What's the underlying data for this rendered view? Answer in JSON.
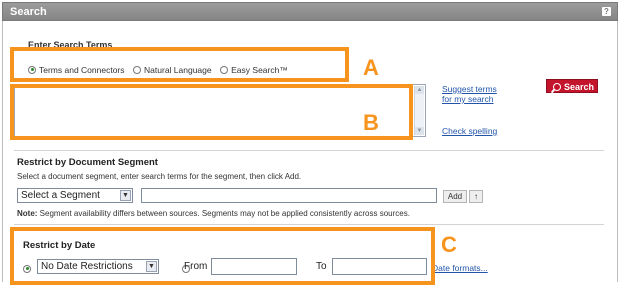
{
  "window": {
    "title": "Search",
    "help_label": "?"
  },
  "enter_terms": {
    "heading": "Enter Search Terms",
    "options": [
      {
        "label": "Terms and Connectors",
        "selected": true
      },
      {
        "label": "Natural Language",
        "selected": false
      },
      {
        "label": "Easy Search™",
        "selected": false
      }
    ],
    "query_value": "",
    "suggest_link": "Suggest terms for my search",
    "suggest_line1": "Suggest terms",
    "suggest_line2": "for my search",
    "spelling_link": "Check spelling",
    "search_button": "Search"
  },
  "segment": {
    "heading": "Restrict by Document Segment",
    "instructions": "Select a document segment, enter search terms for the segment, then click Add.",
    "select_value": "Select a Segment",
    "terms_value": "",
    "add_button": "Add",
    "up_button": "↑",
    "note_label": "Note:",
    "note_text": " Segment availability differs between sources. Segments may not be applied consistently across sources."
  },
  "date": {
    "heading": "Restrict by Date",
    "select_value": "No Date Restrictions",
    "select_radio_selected": true,
    "from_label": "From",
    "from_value": "",
    "to_label": "To",
    "to_value": "",
    "formats_link": "Date formats..."
  },
  "callouts": {
    "a": "A",
    "b": "B",
    "c": "C"
  },
  "colors": {
    "callout_orange": "#f7941d",
    "search_button_red": "#c4142c",
    "link_blue": "#2255aa",
    "titlebar_gray": "#8f8f8f"
  }
}
